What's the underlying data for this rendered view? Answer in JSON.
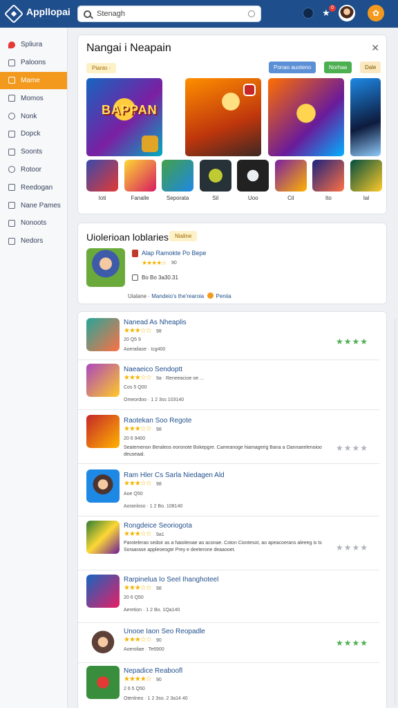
{
  "topbar": {
    "app_title": "Appllopai",
    "app_subtitle": "· · · · · · · · ·",
    "search_value": "Stenagh",
    "notification_count": "0",
    "profile_icon": "badge-icon"
  },
  "sidebar": {
    "items": [
      {
        "label": "Spliura",
        "icon": "pin-icon"
      },
      {
        "label": "Paloons",
        "icon": "bag-icon"
      },
      {
        "label": "Mame",
        "icon": "home-icon",
        "active": true
      },
      {
        "label": "Momos",
        "icon": "grid-icon"
      },
      {
        "label": "Nonk",
        "icon": "circle-icon"
      },
      {
        "label": "Dopck",
        "icon": "shield-icon"
      },
      {
        "label": "Soonts",
        "icon": "bolt-icon"
      },
      {
        "label": "Rotoor",
        "icon": "gear-icon"
      },
      {
        "label": "Reedogan",
        "icon": "chat-icon"
      },
      {
        "label": "Nane Pames",
        "icon": "list-icon"
      },
      {
        "label": "Nonoots",
        "icon": "doc-icon"
      },
      {
        "label": "Nedors",
        "icon": "folder-icon"
      }
    ]
  },
  "featured": {
    "title": "Nangai i Neapain",
    "tag": "Pianio ·",
    "filters": [
      "Ponao auoteno",
      "Norhaa",
      "Dale"
    ],
    "banner_text": "BAPPAN",
    "thumbs": [
      {
        "label": "Ioti"
      },
      {
        "label": "Fanalle"
      },
      {
        "label": "Seporata"
      },
      {
        "label": "Sil"
      },
      {
        "label": "Uoo"
      },
      {
        "label": "Cil"
      },
      {
        "label": "Ito"
      },
      {
        "label": "Ial"
      }
    ]
  },
  "recent": {
    "title": "Uiolerioan loblaries",
    "tag": "Nialine",
    "game_title": "Alap Ramokte Po Bepe",
    "stars": "★★★★☆",
    "rating": "90",
    "meta": "Bo Bo 3a30.31",
    "footer_prefix": "Uialane ·",
    "footer_link": "Mandeio's the'rearoia",
    "footer_suffix": "Peniia"
  },
  "list": [
    {
      "title": "Nanead As Nheaplis",
      "stars": "★★★☆☆",
      "rating": "98",
      "sub": "20 Q5 9",
      "meta": "Aoeraliase · Icg400",
      "trail": "★★★★",
      "trail_style": "green"
    },
    {
      "title": "Naeaeico Sendoptt",
      "stars": "★★★☆☆",
      "rating": "9a · Reneeacioe oe ...",
      "sub": "Cos 5 Q00",
      "meta": "Omeordoo · 1 2 3ss 103140",
      "trail": "",
      "trail_style": "none"
    },
    {
      "title": "Raotekan Soo Regote",
      "stars": "★★★☆☆",
      "rating": "98",
      "sub": "20 6 9400",
      "desc": "Seatemenon Beraleos eoronote Bokepgre. Cameanoge hiamagerig Bana a Oannaeelenoioo deuseaal.",
      "trail": "★★★★",
      "trail_style": "grey"
    },
    {
      "title": "Ram Hler Cs Sarla Niedagen Ald",
      "stars": "★★★☆☆",
      "rating": "98",
      "sub": "Aoe Q50",
      "meta": "Aoranloso · 1 2 Bo. 108140",
      "trail": "",
      "trail_style": "none"
    },
    {
      "title": "Rongdeice Seoriogota",
      "stars": "★★★☆☆",
      "rating": "9a1",
      "sub": "",
      "desc": "Parotelerao sedoir as a haioiteoae ao aconae. Coton Ciontesot, ao apeacoerans aleeeg is ts Soraarase appleoeogte Prey e deeterone deaaooet.",
      "trail": "★★★★",
      "trail_style": "grey"
    },
    {
      "title": "Rarpinelua Io Seel Ihanghoteel",
      "stars": "★★★☆☆",
      "rating": "98",
      "sub": "20 6 Q50",
      "meta": "Aeretion · 1 2 Bo. 1Qa140",
      "trail": "",
      "trail_style": "none"
    },
    {
      "title": "Unooe Iaon Seo Reopadle",
      "stars": "★★★☆☆",
      "rating": "90",
      "sub": "",
      "meta": "Aoeroliae · Te6900",
      "trail": "★★★★",
      "trail_style": "green"
    },
    {
      "title": "Nepadice Reaboofl",
      "stars": "★★★★☆",
      "rating": "90",
      "sub": "2 6 5 Q50",
      "meta": "Otenlneo · 1 2 3so. 2 3a14 40",
      "trail": "",
      "trail_style": "none"
    }
  ]
}
